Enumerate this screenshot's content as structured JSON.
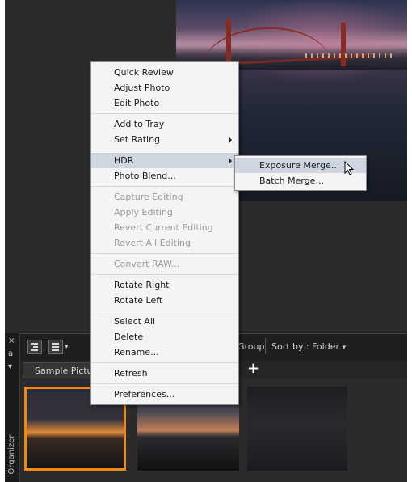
{
  "context_menu": {
    "groups": [
      [
        {
          "label": "Quick Review"
        },
        {
          "label": "Adjust Photo"
        },
        {
          "label": "Edit Photo"
        }
      ],
      [
        {
          "label": "Add to Tray"
        },
        {
          "label": "Set Rating"
        }
      ],
      [
        {
          "label": "HDR"
        },
        {
          "label": "Photo Blend..."
        }
      ],
      [
        {
          "label": "Capture Editing"
        },
        {
          "label": "Apply Editing"
        },
        {
          "label": "Revert Current Editing"
        },
        {
          "label": "Revert All Editing"
        }
      ],
      [
        {
          "label": "Convert RAW..."
        }
      ],
      [
        {
          "label": "Rotate Right"
        },
        {
          "label": "Rotate Left"
        }
      ],
      [
        {
          "label": "Select All"
        },
        {
          "label": "Delete"
        },
        {
          "label": "Rename..."
        }
      ],
      [
        {
          "label": "Refresh"
        }
      ],
      [
        {
          "label": "Preferences..."
        }
      ]
    ]
  },
  "hdr_submenu": {
    "items": [
      {
        "label": "Exposure Merge..."
      },
      {
        "label": "Batch Merge..."
      }
    ]
  },
  "organizer": {
    "side_label": "Organizer",
    "close_glyph": "×",
    "pin_glyph": "a",
    "collapse_glyph": "▾",
    "toolbar": {
      "group_label": "Group",
      "sort_by_label": "Sort by :",
      "sort_value": "Folder",
      "dropdown_glyph": "▾"
    },
    "tab_label": "Sample Picture",
    "add_tab_glyph": "+"
  },
  "colors": {
    "selection_border": "#f08a12",
    "menu_highlight": "#cfd6e2",
    "menu_background": "#f4f4f4"
  }
}
